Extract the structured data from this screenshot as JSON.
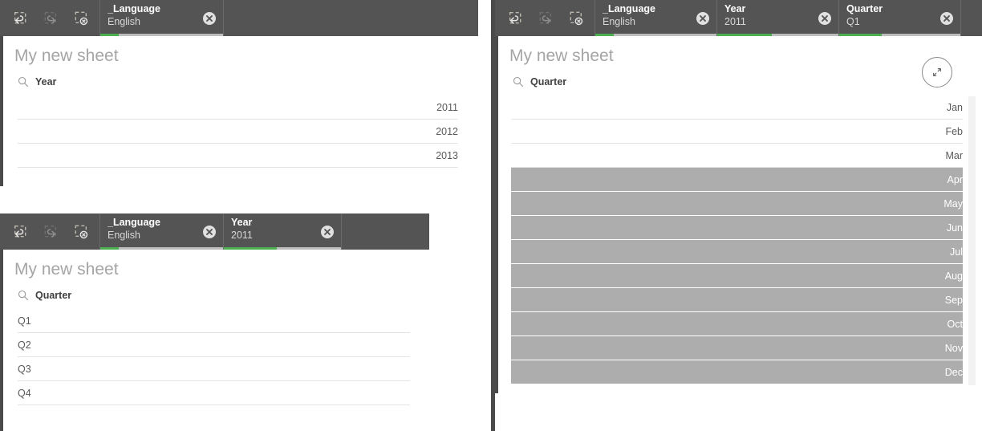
{
  "theme": {
    "toolbar_bg": "#545454",
    "chip_field_color": "#ffffff",
    "chip_value_color": "#d8d8d8",
    "selection_green": "#4caf50",
    "excluded_row_bg": "#adadad",
    "excluded_row_text": "#ffffff",
    "optional_row_text": "#595959",
    "sheet_title_color": "#a5a5a5",
    "panel_edge": "#4a4a4a"
  },
  "toolbar_actions": [
    {
      "name": "step-back",
      "label": "Step back",
      "enabled": true
    },
    {
      "name": "step-forward",
      "label": "Step forward",
      "enabled": false
    },
    {
      "name": "clear-all-selections",
      "label": "Clear all selections",
      "enabled": true
    }
  ],
  "panels": [
    {
      "id": "panel-year",
      "sheet_title": "My new sheet",
      "chips": [
        {
          "field": "_Language",
          "value": "English",
          "bar_percent": 15
        }
      ],
      "listbox": {
        "title": "Year",
        "align": "right",
        "rows": [
          {
            "value": "2011",
            "state": "optional"
          },
          {
            "value": "2012",
            "state": "optional"
          },
          {
            "value": "2013",
            "state": "optional"
          }
        ]
      }
    },
    {
      "id": "panel-quarter",
      "sheet_title": "My new sheet",
      "chips": [
        {
          "field": "_Language",
          "value": "English",
          "bar_percent": 15
        },
        {
          "field": "Year",
          "value": "2011",
          "bar_percent": 45
        }
      ],
      "listbox": {
        "title": "Quarter",
        "align": "left",
        "rows": [
          {
            "value": "Q1",
            "state": "optional"
          },
          {
            "value": "Q2",
            "state": "optional"
          },
          {
            "value": "Q3",
            "state": "optional"
          },
          {
            "value": "Q4",
            "state": "optional"
          }
        ]
      }
    },
    {
      "id": "panel-month",
      "sheet_title": "My new sheet",
      "chips": [
        {
          "field": "_Language",
          "value": "English",
          "bar_percent": 15
        },
        {
          "field": "Year",
          "value": "2011",
          "bar_percent": 45
        },
        {
          "field": "Quarter",
          "value": "Q1",
          "bar_percent": 35
        }
      ],
      "listbox": {
        "title": "Quarter",
        "align": "right",
        "rows": [
          {
            "value": "Jan",
            "state": "optional"
          },
          {
            "value": "Feb",
            "state": "optional"
          },
          {
            "value": "Mar",
            "state": "optional"
          },
          {
            "value": "Apr",
            "state": "excluded"
          },
          {
            "value": "May",
            "state": "excluded"
          },
          {
            "value": "Jun",
            "state": "excluded"
          },
          {
            "value": "Jul",
            "state": "excluded"
          },
          {
            "value": "Aug",
            "state": "excluded"
          },
          {
            "value": "Sep",
            "state": "excluded"
          },
          {
            "value": "Oct",
            "state": "excluded"
          },
          {
            "value": "Nov",
            "state": "excluded"
          },
          {
            "value": "Dec",
            "state": "excluded"
          }
        ]
      },
      "expand_button": {
        "name": "expand-icon",
        "label": "Expand"
      }
    }
  ]
}
